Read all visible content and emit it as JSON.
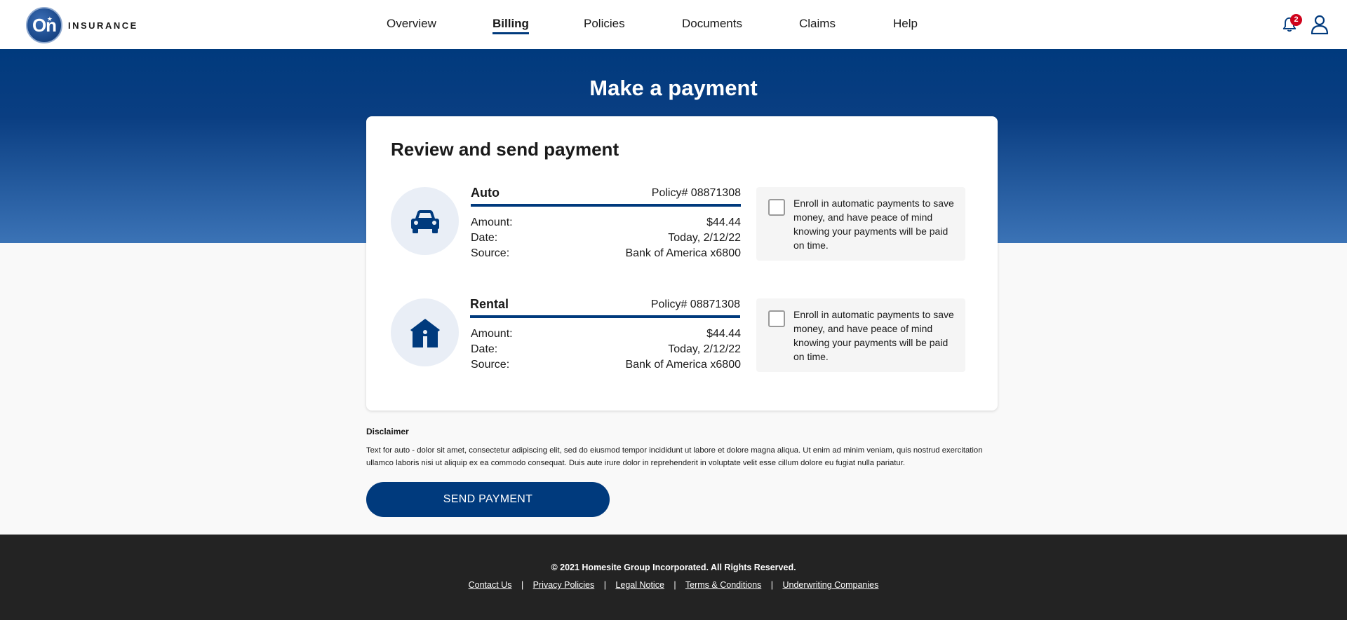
{
  "header": {
    "logo_mark": "On",
    "logo_text": "INSURANCE",
    "nav": [
      {
        "label": "Overview"
      },
      {
        "label": "Billing",
        "active": true
      },
      {
        "label": "Policies"
      },
      {
        "label": "Documents"
      },
      {
        "label": "Claims"
      },
      {
        "label": "Help"
      }
    ],
    "notification_count": "2",
    "icons": [
      "bell-icon",
      "user-icon"
    ]
  },
  "hero": {
    "title": "Make a payment"
  },
  "card": {
    "title": "Review and send payment",
    "payments": [
      {
        "name": "Auto",
        "icon": "car-icon",
        "policy": "Policy# 08871308",
        "amount_label": "Amount:",
        "amount": "$44.44",
        "date_label": "Date:",
        "date": "Today, 2/12/22",
        "source_label": "Source:",
        "source": "Bank of America x6800",
        "enroll_checked": false,
        "enroll_text": "Enroll in automatic payments to save money, and have peace of mind knowing your payments will be paid on time."
      },
      {
        "name": "Rental",
        "icon": "house-icon",
        "policy": "Policy# 08871308",
        "amount_label": "Amount:",
        "amount": "$44.44",
        "date_label": "Date:",
        "date": "Today, 2/12/22",
        "source_label": "Source:",
        "source": "Bank of America x6800",
        "enroll_checked": false,
        "enroll_text": "Enroll in automatic payments to save money, and have peace of mind knowing your payments will be paid on time."
      }
    ]
  },
  "disclaimer": {
    "title": "Disclaimer",
    "text": "Text for auto - dolor sit amet, consectetur adipiscing elit, sed do eiusmod tempor incididunt ut labore et dolore magna aliqua. Ut enim ad minim veniam, quis nostrud exercitation ullamco laboris nisi ut aliquip ex ea commodo consequat. Duis aute irure dolor in reprehenderit in voluptate velit esse cillum dolore eu fugiat nulla pariatur."
  },
  "send_button": "SEND PAYMENT",
  "footer": {
    "copyright": "© 2021 Homesite Group Incorporated. All Rights Reserved.",
    "separator": "|",
    "links": [
      "Contact Us",
      "Privacy Policies",
      "Legal Notice",
      "Terms & Conditions",
      "Underwriting Companies"
    ]
  },
  "colors": {
    "brand_blue": "#003a7d",
    "badge_red": "#d0021b",
    "footer_bg": "#232323"
  }
}
